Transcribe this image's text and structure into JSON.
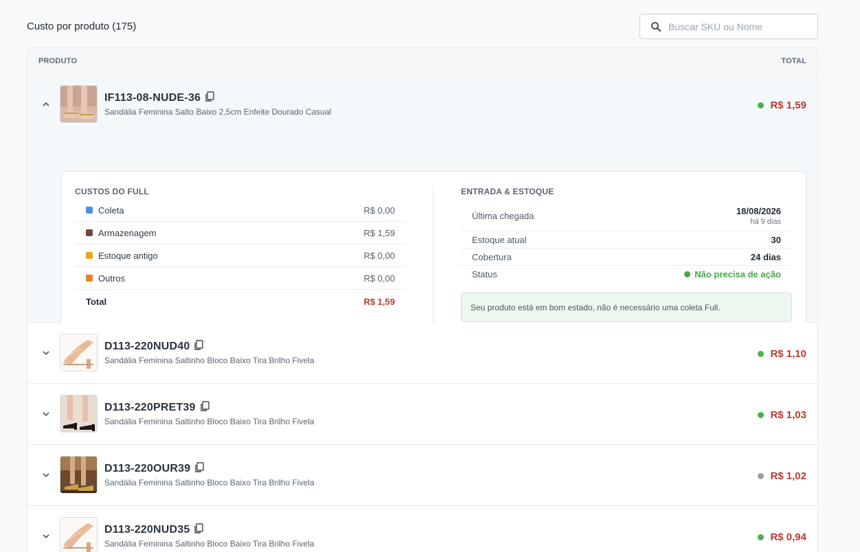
{
  "header": {
    "title": "Custo por produto (175)"
  },
  "search": {
    "placeholder": "Buscar SKU ou Nome",
    "value": ""
  },
  "table": {
    "col_product": "PRODUTO",
    "col_total": "TOTAL"
  },
  "rows": [
    {
      "sku": "IF113-08-NUDE-36",
      "name": "Sandália Feminina Salto Baixo 2,5cm Enfeite Dourado Casual",
      "total": "R$ 1,59",
      "status_color": "#4caf50",
      "expanded": true
    },
    {
      "sku": "D113-220NUD40",
      "name": "Sandália Feminina Saltinho Bloco Baixo Tira Brilho Fivela",
      "total": "R$ 1,10",
      "status_color": "#4caf50",
      "expanded": false
    },
    {
      "sku": "D113-220PRET39",
      "name": "Sandália Feminina Saltinho Bloco Baixo Tira Brilho Fivela",
      "total": "R$ 1,03",
      "status_color": "#4caf50",
      "expanded": false
    },
    {
      "sku": "D113-220OUR39",
      "name": "Sandália Feminina Saltinho Bloco Baixo Tira Brilho Fivela",
      "total": "R$ 1,02",
      "status_color": "#9e9e9e",
      "expanded": false
    },
    {
      "sku": "D113-220NUD35",
      "name": "Sandália Feminina Saltinho Bloco Baixo Tira Brilho Fivela",
      "total": "R$ 0,94",
      "status_color": "#4caf50",
      "expanded": false
    }
  ],
  "details": {
    "costs_title": "CUSTOS DO FULL",
    "costs": [
      {
        "label": "Coleta",
        "value": "R$ 0,00",
        "color": "#4a90e2"
      },
      {
        "label": "Armazenagem",
        "value": "R$ 1,59",
        "color": "#6b4a3a"
      },
      {
        "label": "Estoque antigo",
        "value": "R$ 0,00",
        "color": "#e6a817"
      },
      {
        "label": "Outros",
        "value": "R$ 0,00",
        "color": "#f0801e"
      }
    ],
    "total_label": "Total",
    "total_value": "R$ 1,59",
    "stock_title": "ENTRADA & ESTOQUE",
    "last_arrival_label": "Última chegada",
    "last_arrival_date": "18/08/2026",
    "last_arrival_ago": "há 9 dias",
    "stock_label": "Estoque atual",
    "stock_value": "30",
    "coverage_label": "Cobertura",
    "coverage_value": "24 dias",
    "status_label": "Status",
    "status_value": "Não precisa de ação",
    "notice": "Seu produto está em bom estado, não é necessário uma coleta Full."
  },
  "colors": {
    "accent_red": "#b83a2e",
    "ok_green": "#45a845"
  },
  "icons": [
    "search-icon",
    "chevron-up-icon",
    "chevron-down-icon",
    "copy-icon"
  ]
}
